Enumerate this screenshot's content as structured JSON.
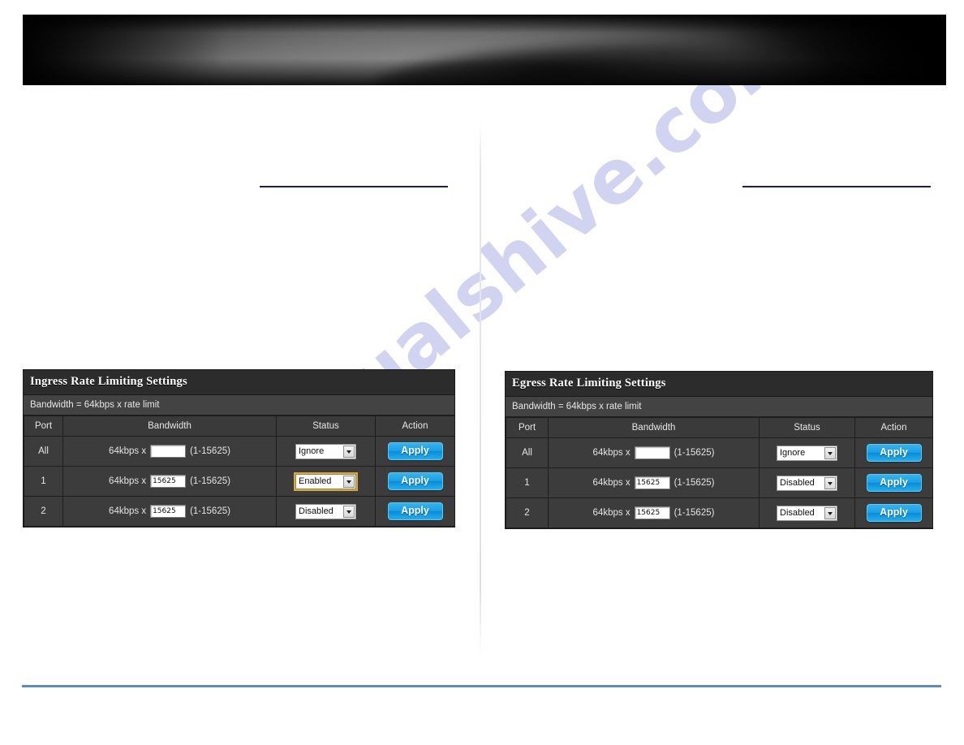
{
  "page": {
    "watermark": "manualshive.com",
    "banner_alt": "product-banner",
    "colors": {
      "nav_rule": "#141a7a",
      "footer_rule": "#5b8cc4",
      "panel_title_bg": "#2c2c2c",
      "panel_body_bg": "#3c3c3c",
      "apply_button": "#1aa0e6",
      "focus_outline": "#d7a83c"
    }
  },
  "panels": [
    {
      "id": "ingress",
      "title": "Ingress Rate Limiting Settings",
      "subtitle": "Bandwidth = 64kbps x rate limit",
      "columns": [
        "Port",
        "Bandwidth",
        "Status",
        "Action"
      ],
      "rows": [
        {
          "port": "All",
          "bandwidth_prefix": "64kbps x",
          "bandwidth_value": "",
          "bandwidth_range": "(1-15625)",
          "status": "Ignore",
          "status_focused": false,
          "action": "Apply"
        },
        {
          "port": "1",
          "bandwidth_prefix": "64kbps x",
          "bandwidth_value": "15625",
          "bandwidth_range": "(1-15625)",
          "status": "Enabled",
          "status_focused": true,
          "action": "Apply"
        },
        {
          "port": "2",
          "bandwidth_prefix": "64kbps x",
          "bandwidth_value": "15625",
          "bandwidth_range": "(1-15625)",
          "status": "Disabled",
          "status_focused": false,
          "action": "Apply"
        }
      ]
    },
    {
      "id": "egress",
      "title": "Egress Rate Limiting Settings",
      "subtitle": "Bandwidth = 64kbps x rate limit",
      "columns": [
        "Port",
        "Bandwidth",
        "Status",
        "Action"
      ],
      "rows": [
        {
          "port": "All",
          "bandwidth_prefix": "64kbps x",
          "bandwidth_value": "",
          "bandwidth_range": "(1-15625)",
          "status": "Ignore",
          "status_focused": false,
          "action": "Apply"
        },
        {
          "port": "1",
          "bandwidth_prefix": "64kbps x",
          "bandwidth_value": "15625",
          "bandwidth_range": "(1-15625)",
          "status": "Disabled",
          "status_focused": false,
          "action": "Apply"
        },
        {
          "port": "2",
          "bandwidth_prefix": "64kbps x",
          "bandwidth_value": "15625",
          "bandwidth_range": "(1-15625)",
          "status": "Disabled",
          "status_focused": false,
          "action": "Apply"
        }
      ]
    }
  ],
  "status_options": [
    "Ignore",
    "Enabled",
    "Disabled"
  ]
}
